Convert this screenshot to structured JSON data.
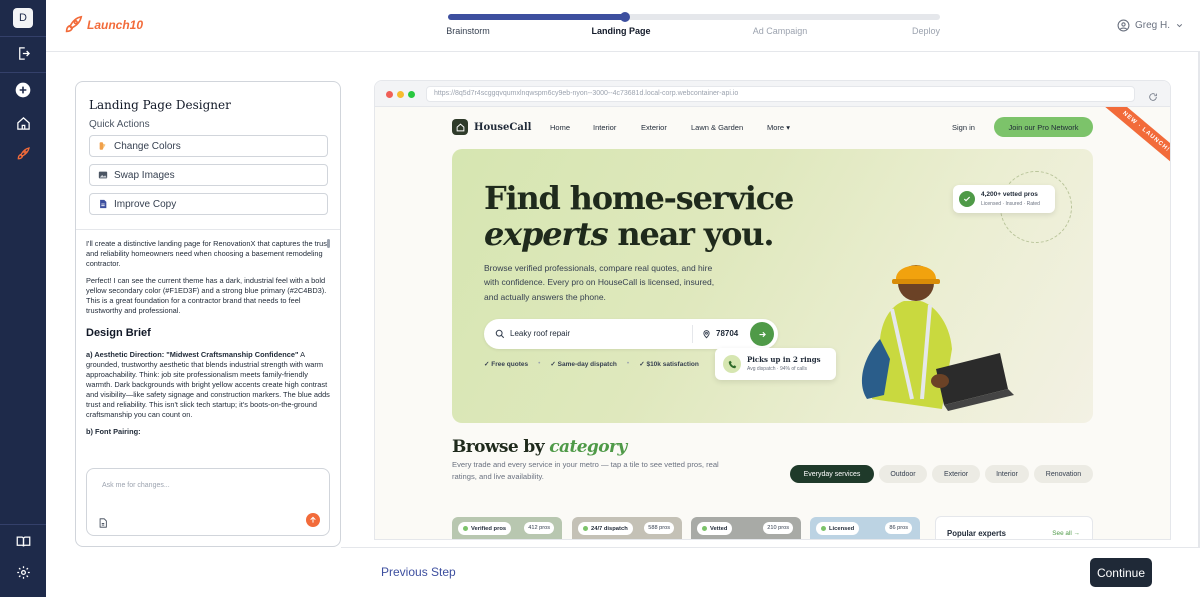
{
  "rail": {
    "avatar_letter": "D",
    "icons": [
      "logout-icon",
      "add-icon",
      "home-icon",
      "rocket-icon",
      "book-icon",
      "settings-icon"
    ]
  },
  "header": {
    "logo_text": "Launch10",
    "brand_color": "#f26b3a",
    "accent_color": "#3d4f9f",
    "progress_fraction": 0.36,
    "steps": [
      {
        "label": "Brainstorm",
        "state": "done"
      },
      {
        "label": "Landing Page",
        "state": "current"
      },
      {
        "label": "Ad Campaign",
        "state": "upcoming"
      },
      {
        "label": "Deploy",
        "state": "upcoming"
      }
    ],
    "user_name": "Greg H."
  },
  "designer": {
    "title": "Landing Page Designer",
    "quick_actions_label": "Quick Actions",
    "actions": [
      {
        "label": "Change Colors",
        "icon": "palette-icon"
      },
      {
        "label": "Swap Images",
        "icon": "image-icon"
      },
      {
        "label": "Improve Copy",
        "icon": "document-icon"
      }
    ],
    "chat": {
      "msg1": "I'll create a distinctive landing page for RenovationX that captures the trust and reliability homeowners need when choosing a basement remodeling contractor.",
      "msg2": "Perfect! I can see the current theme has a dark, industrial feel with a bold yellow secondary color (#F1ED3F) and a strong blue primary (#2C4BD3). This is a great foundation for a contractor brand that needs to feel trustworthy and professional.",
      "brief_heading": "Design Brief",
      "aesthetic_label": "a) Aesthetic Direction: \"Midwest Craftsmanship Confidence\"",
      "aesthetic_text": " A grounded, trustworthy aesthetic that blends industrial strength with warm approachability. Think: job site professionalism meets family-friendly warmth. Dark backgrounds with bright yellow accents create high contrast and visibility—like safety signage and construction markers. The blue adds trust and reliability. This isn't slick tech startup; it's boots-on-the-ground craftsmanship you can count on.",
      "font_label": "b) Font Pairing:"
    },
    "composer_placeholder": "Ask me for changes..."
  },
  "preview": {
    "url": "https://8q5d7r4scggqvqumxlnqwspm6cy9eb-nyon--3000--4c73681d.local-corp.webcontainer-api.io",
    "site": {
      "brand": "HouseCall",
      "nav": [
        "Home",
        "Interior",
        "Exterior",
        "Lawn & Garden",
        "More"
      ],
      "sign_in": "Sign in",
      "cta": "Join our Pro Network",
      "ribbon": "NEW · LAUNCH!",
      "hero_line1": "Find home-service",
      "hero_line2_em": "experts",
      "hero_line2_rest": " near you.",
      "hero_sub": "Browse verified professionals, compare real quotes, and hire with confidence. Every pro on HouseCall is licensed, insured, and actually answers the phone.",
      "search_query": "Leaky roof repair",
      "zip": "78704",
      "perks": [
        "Free quotes",
        "Same-day dispatch",
        "$10k satisfaction"
      ],
      "badge_vetted_title": "4,200+ vetted pros",
      "badge_vetted_sub": "Licensed · Insured · Rated",
      "badge_rings_title": "Picks up in 2 rings",
      "badge_rings_sub": "Avg dispatch · 94% of calls",
      "browse_heading": "Browse by ",
      "browse_heading_em": "category",
      "browse_sub": "Every trade and every service in your metro — tap a tile to see vetted pros, real ratings, and live availability.",
      "filters": [
        {
          "label": "Everyday services",
          "active": true
        },
        {
          "label": "Outdoor",
          "active": false
        },
        {
          "label": "Exterior",
          "active": false
        },
        {
          "label": "Interior",
          "active": false
        },
        {
          "label": "Renovation",
          "active": false
        }
      ],
      "cards": [
        {
          "tag": "Verified pros",
          "count": "412 pros"
        },
        {
          "tag": "24/7 dispatch",
          "count": "588 pros"
        },
        {
          "tag": "Vetted",
          "count": "210 pros"
        },
        {
          "tag": "Licensed",
          "count": "86 pros"
        }
      ],
      "popular_title": "Popular experts",
      "see_all": "See all →"
    }
  },
  "footer": {
    "prev": "Previous Step",
    "next": "Continue"
  }
}
